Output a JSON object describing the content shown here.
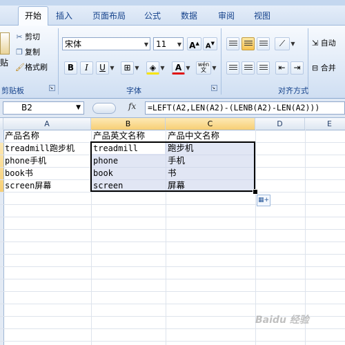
{
  "ribbon_tabs": [
    "开始",
    "插入",
    "页面布局",
    "公式",
    "数据",
    "审阅",
    "视图"
  ],
  "clipboard": {
    "paste_partial": "贴",
    "cut": "剪切",
    "copy": "复制",
    "format_painter": "格式刷",
    "group_label": "剪贴板"
  },
  "font": {
    "name": "宋体",
    "size": "11",
    "group_label": "字体",
    "bold": "B",
    "italic": "I",
    "underline": "U",
    "font_color_letter": "A",
    "phonetic": "wén"
  },
  "alignment": {
    "group_label": "对齐方式",
    "wrap_text_partial": "自动",
    "merge_partial": "合并"
  },
  "formula_bar": {
    "name_box": "B2",
    "fx": "fx",
    "formula": "=LEFT(A2,LEN(A2)-(LENB(A2)-LEN(A2)))"
  },
  "sheet": {
    "columns": [
      "A",
      "B",
      "C",
      "D",
      "E"
    ],
    "rows": [
      [
        "产品名称",
        "产品英文名称",
        "产品中文名称"
      ],
      [
        "treadmill跑步机",
        "treadmill",
        "跑步机"
      ],
      [
        "phone手机",
        "phone",
        "手机"
      ],
      [
        "book书",
        "book",
        "书"
      ],
      [
        "screen屏幕",
        "screen",
        "屏幕"
      ]
    ]
  },
  "watermark": "Baidu 经验",
  "colors": {
    "ribbon_text": "#15428b",
    "selection_fill": "#c8d2eb",
    "selected_header": "#f7cf74"
  }
}
